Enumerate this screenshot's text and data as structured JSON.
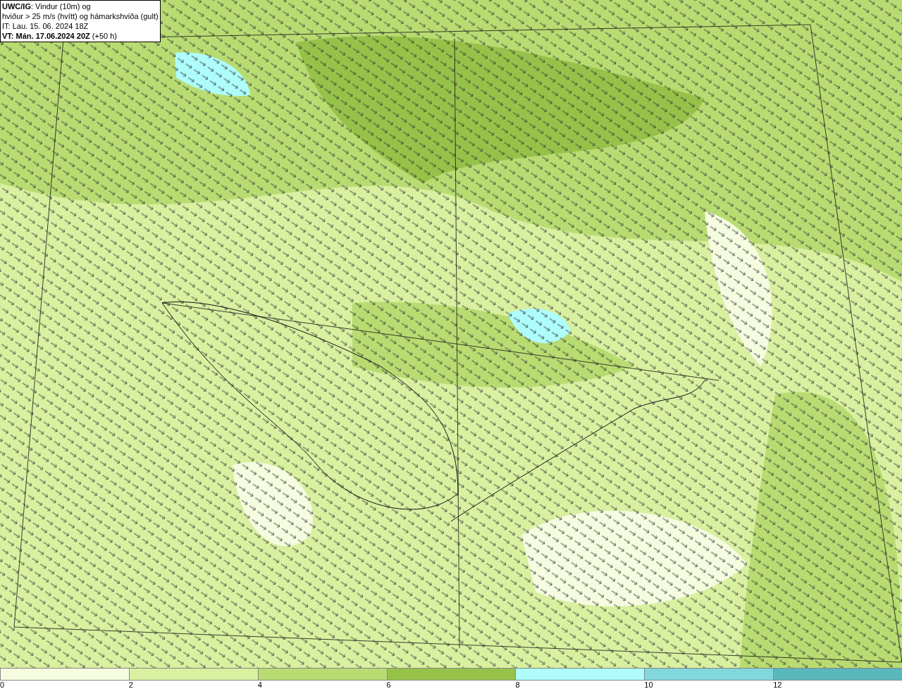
{
  "title_box": {
    "lines": [
      "**UWC/IG**: Vindur (10m) og",
      "hviður > 25 m/s (hvítt) og hámarkshviða (gult)",
      "IT: Lau. 15. 06. 2024 18Z",
      "**VT: Mán. 17.06.2024 20Z** (+50 h)"
    ]
  },
  "legend": {
    "bins": [
      {
        "color": "#f5fce0",
        "label": "0"
      },
      {
        "color": "#d8f0a0",
        "label": "2"
      },
      {
        "color": "#b8dc72",
        "label": "4"
      },
      {
        "color": "#97c24a",
        "label": "6"
      },
      {
        "color": "#aefcfc",
        "label": "8"
      },
      {
        "color": "#80d8dc",
        "label": "10"
      },
      {
        "color": "#58b8bc",
        "label": "12"
      }
    ]
  }
}
